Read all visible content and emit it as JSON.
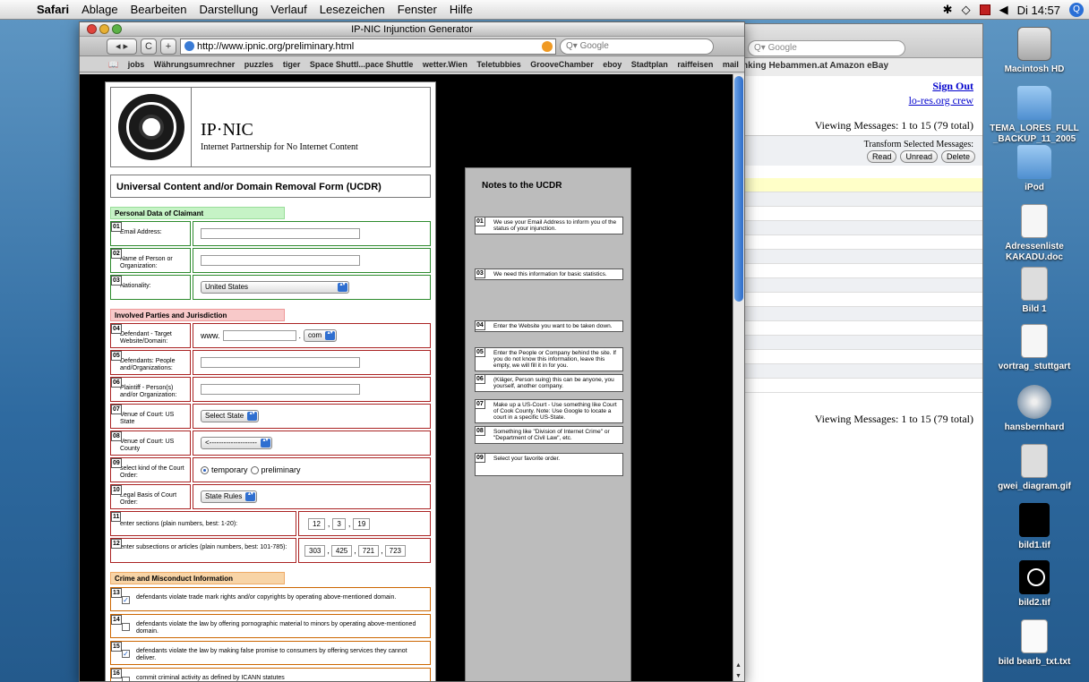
{
  "menubar": {
    "app": "Safari",
    "items": [
      "Ablage",
      "Bearbeiten",
      "Darstellung",
      "Verlauf",
      "Lesezeichen",
      "Fenster",
      "Hilfe"
    ],
    "clock": "Di 14:57"
  },
  "desktop_icons": [
    {
      "label": "Macintosh HD",
      "kind": "hd"
    },
    {
      "label": "TEMA_LORES_FULL_BACKUP_11_2005",
      "kind": "folder"
    },
    {
      "label": "iPod",
      "kind": "folder"
    },
    {
      "label": "Adressenliste KAKADU.doc",
      "kind": "doc"
    },
    {
      "label": "Bild 1",
      "kind": "png"
    },
    {
      "label": "vortrag_stuttgart",
      "kind": "doc"
    },
    {
      "label": "hansbernhard",
      "kind": "disk"
    },
    {
      "label": "gwei_diagram.gif",
      "kind": "png"
    },
    {
      "label": "bild1.tif",
      "kind": "black"
    },
    {
      "label": "bild2.tif",
      "kind": "blackring"
    },
    {
      "label": "bild bearb_txt.txt",
      "kind": "txt"
    }
  ],
  "background_window": {
    "search_placeholder": "Google",
    "bookmarks": "nking   Hebammen.at   Amazon   eBay",
    "sign_out": "Sign Out",
    "crew": "lo-res.org crew",
    "viewing_top": "Viewing Messages: 1 to 15 (79 total)",
    "viewing_bottom": "Viewing Messages: 1 to 15 (79 total)",
    "transform_title": "Transform Selected Messages:",
    "buttons": [
      "Read",
      "Unread",
      "Delete"
    ]
  },
  "window": {
    "title": "IP-NIC Injunction Generator",
    "url": "http://www.ipnic.org/preliminary.html",
    "search_placeholder": "Google",
    "bookmarks": [
      "jobs",
      "Währungsumrechner",
      "puzzles",
      "tiger",
      "Space Shuttl...pace Shuttle",
      "wetter.Wien",
      "Teletubbies",
      "GrooveChamber",
      "eboy",
      "Stadtplan",
      "raiffeisen",
      "mail"
    ]
  },
  "form": {
    "org_name": "IP·NIC",
    "org_full": "Internet Partnership for No Internet Content",
    "title": "Universal Content and/or Domain Removal Form (UCDR)",
    "sections": {
      "personal": "Personal Data of Claimant",
      "parties": "Involved Parties and Jurisdiction",
      "crime": "Crime and Misconduct Information"
    },
    "fields": {
      "f01": {
        "num": "01",
        "label": "Email Address:"
      },
      "f02": {
        "num": "02",
        "label": "Name of Person or Organization:"
      },
      "f03": {
        "num": "03",
        "label": "Nationality:",
        "value": "United States"
      },
      "f04": {
        "num": "04",
        "label": "Defendant - Target Website/Domain:",
        "prefix": "www.",
        "tld": "com"
      },
      "f05": {
        "num": "05",
        "label": "Defendants: People and/Organizations:"
      },
      "f06": {
        "num": "06",
        "label": "Plaintiff - Person(s) and/or Organization:"
      },
      "f07": {
        "num": "07",
        "label": "Venue of Court: US State",
        "value": "Select State"
      },
      "f08": {
        "num": "08",
        "label": "Venue of Court: US County",
        "value": "<--------------------"
      },
      "f09": {
        "num": "09",
        "label": "select kind of the Court Order:",
        "opt1": "temporary",
        "opt2": "preliminary"
      },
      "f10": {
        "num": "10",
        "label": "Legal Basis of Court Order:",
        "value": "State Rules"
      },
      "f11": {
        "num": "11",
        "label": "enter sections (plain numbers, best: 1-20):",
        "values": [
          "12",
          "3",
          "19"
        ]
      },
      "f12": {
        "num": "12",
        "label": "enter subsections or articles (plain numbers, best: 101-785):",
        "values": [
          "303",
          "425",
          "721",
          "723"
        ]
      }
    },
    "crimes": [
      {
        "num": "13",
        "text": "defendants violate trade mark rights and/or copyrights by operating above-mentioned domain.",
        "checked": true
      },
      {
        "num": "14",
        "text": "defendants violate the law by offering pornographic material to minors by operating above-mentioned domain.",
        "checked": false
      },
      {
        "num": "15",
        "text": "defendants violate the law by making false promise to consumers by offering services they cannot deliver.",
        "checked": true
      },
      {
        "num": "16",
        "text": "commit criminal activity as defined by ICANN statutes",
        "checked": false
      }
    ]
  },
  "notes": {
    "title": "Notes to the UCDR",
    "items": [
      {
        "num": "01",
        "text": "We use your Email Address to inform you of the status of your injunction."
      },
      {
        "num": "03",
        "text": "We need this information for basic statistics."
      },
      {
        "num": "04",
        "text": "Enter the Website you want to be taken down."
      },
      {
        "num": "05",
        "text": "Enter the People or Company behind the site. If you do not know this information, leave this empty, we will fill it in for you."
      },
      {
        "num": "06",
        "text": "(Kläger, Person suing) this can be anyone, you yourself, another company."
      },
      {
        "num": "07",
        "text": "Make up a US-Court - Use something like Court of Cook County. Note: Use Google to locate a court in a specific US-State."
      },
      {
        "num": "08",
        "text": "Something like \"Division of Internet Crime\" or \"Department of Civil Law\", etc."
      },
      {
        "num": "09",
        "text": "Select your favorite order."
      }
    ]
  }
}
